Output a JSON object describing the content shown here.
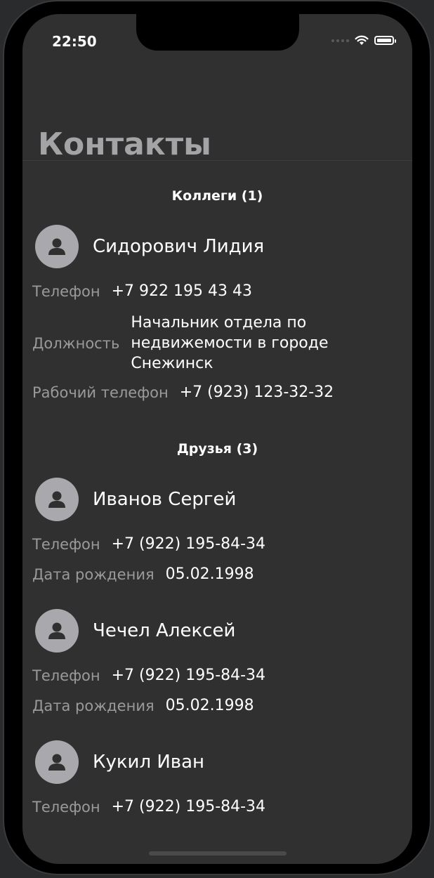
{
  "status_bar": {
    "time": "22:50"
  },
  "header": {
    "title": "Контакты"
  },
  "sections": [
    {
      "title": "Коллеги (1)",
      "contacts": [
        {
          "name": "Сидорович Лидия",
          "fields": [
            {
              "label": "Телефон",
              "value": "+7 922 195 43 43"
            },
            {
              "label": "Должность",
              "value": "Начальник отдела по недвижемости в городе Снежинск"
            },
            {
              "label": "Рабочий телефон",
              "value": "+7 (923) 123-32-32"
            }
          ]
        }
      ]
    },
    {
      "title": "Друзья (3)",
      "contacts": [
        {
          "name": "Иванов Сергей",
          "fields": [
            {
              "label": "Телефон",
              "value": "+7 (922) 195-84-34"
            },
            {
              "label": "Дата рождения",
              "value": "05.02.1998"
            }
          ]
        },
        {
          "name": "Чечел Алексей",
          "fields": [
            {
              "label": "Телефон",
              "value": "+7 (922) 195-84-34"
            },
            {
              "label": "Дата рождения",
              "value": "05.02.1998"
            }
          ]
        },
        {
          "name": "Кукил Иван",
          "fields": [
            {
              "label": "Телефон",
              "value": "+7 (922) 195-84-34"
            }
          ]
        }
      ]
    }
  ],
  "icons": {
    "avatar": "person-icon",
    "wifi": "wifi-icon",
    "battery": "battery-icon",
    "signal": "signal-icon"
  },
  "colors": {
    "background": "#303030",
    "avatar": "#a9a9ad",
    "label": "#9a9a9c",
    "title": "#a4a4a6"
  }
}
